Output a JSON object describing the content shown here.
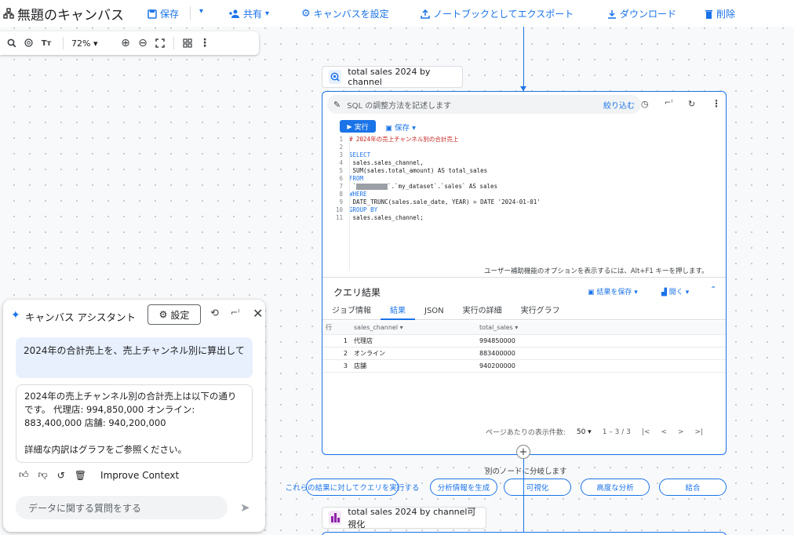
{
  "header": {
    "title": "無題のキャンバス",
    "save": "保存",
    "share": "共有",
    "settings": "キャンバスを設定",
    "export": "ノートブックとしてエクスポート",
    "download": "ダウンロード",
    "delete": "削除"
  },
  "toolbar": {
    "zoom": "72%"
  },
  "query_node": {
    "title": "total sales 2024 by channel",
    "prompt_placeholder": "SQL の調整方法を記述します",
    "filter_button": "絞り込む",
    "run_button": "実行",
    "save_button": "保存",
    "code_lines": [
      {
        "n": "1",
        "text": "# 2024年の売上チャンネル別の合計売上",
        "cls": "cm"
      },
      {
        "n": "2",
        "text": "",
        "cls": "txt"
      },
      {
        "n": "3",
        "text": "SELECT",
        "cls": "kw"
      },
      {
        "n": "4",
        "text": "  sales.sales_channel,",
        "cls": "txt"
      },
      {
        "n": "5",
        "text": "  SUM(sales.total_amount) AS total_sales",
        "cls": "txt"
      },
      {
        "n": "6",
        "text": "FROM",
        "cls": "kw"
      },
      {
        "n": "7",
        "text": "`.`my_dataset`.`sales` AS sales",
        "cls": "txt",
        "masked": true
      },
      {
        "n": "8",
        "text": "WHERE",
        "cls": "kw"
      },
      {
        "n": "9",
        "text": "  DATE_TRUNC(sales.sale_date, YEAR) = DATE '2024-01-01'",
        "cls": "txt"
      },
      {
        "n": "10",
        "text": "GROUP BY",
        "cls": "kw"
      },
      {
        "n": "11",
        "text": "  sales.sales_channel;",
        "cls": "txt"
      }
    ],
    "accessibility_hint": "ユーザー補助機能のオプションを表示するには、Alt+F1 キーを押します。",
    "results_title": "クエリ結果",
    "save_results": "結果を保存",
    "open": "開く",
    "tabs": [
      "ジョブ情報",
      "結果",
      "JSON",
      "実行の詳細",
      "実行グラフ"
    ],
    "active_tab": 1,
    "columns": [
      "行",
      "sales_channel",
      "total_sales"
    ],
    "rows": [
      [
        "1",
        "代理店",
        "994850000"
      ],
      [
        "2",
        "オンライン",
        "883400000"
      ],
      [
        "3",
        "店舗",
        "940200000"
      ]
    ],
    "rows_per_page_label": "ページあたりの表示件数:",
    "rows_per_page": "50",
    "range": "1 – 3 / 3"
  },
  "branch": {
    "label": "別のノードに分岐します",
    "options": [
      "これらの結果に対してクエリを実行する",
      "分析情報を生成",
      "可視化",
      "高度な分析",
      "結合"
    ]
  },
  "viz_node": {
    "title": "total sales 2024 by channel可視化"
  },
  "assistant": {
    "title": "キャンバス アシスタント",
    "settings": "設定",
    "user_message": "2024年の合計売上を、売上チャンネル別に算出して",
    "ai_message_1": "2024年の売上チャンネル別の合計売上は以下の通りです。 代理店: 994,850,000 オンライン: 883,400,000 店舗: 940,200,000",
    "ai_message_2": "詳細な内訳はグラフをご参照ください。",
    "improve": "Improve Context",
    "input_placeholder": "データに関する質問をする"
  },
  "colors": {
    "accent": "#1a73e8",
    "viz_icon": "#8e24aa"
  }
}
